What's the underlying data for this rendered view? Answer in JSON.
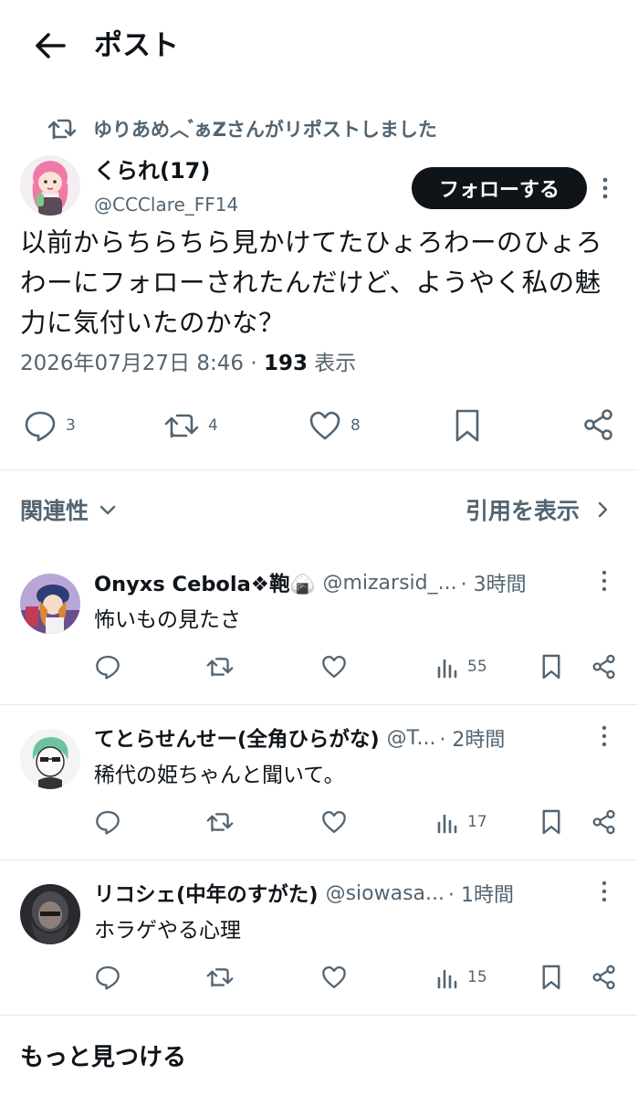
{
  "header": {
    "title": "ポスト"
  },
  "repost_notice": "ゆりあめ︿ ゙ぁZさんがリポストしました",
  "post": {
    "author_name": "くられ(17)",
    "author_handle": "@CCClare_FF14",
    "follow_label": "フォローする",
    "text": "以前からちらちら見かけてたひょろわーのひょろわーにフォローされたんだけど、ようやく私の魅力に気付いたのかな？",
    "timestamp": "2026年07月27日 8:46 · ",
    "views_count": "193",
    "views_label": " 表示",
    "replies": "3",
    "reposts": "4",
    "likes": "8"
  },
  "sort": {
    "label": "関連性",
    "quotes_label": "引用を表示"
  },
  "replies": [
    {
      "name": "Onyxs Cebola❖鞄🍙",
      "handle": "@mizarsid_...",
      "time": "· 3時間",
      "text": "怖いもの見たさ",
      "views": "55"
    },
    {
      "name": "てとらせんせー(全角ひらがな)",
      "handle": "@T...",
      "time": "· 2時間",
      "text": "稀代の姫ちゃんと聞いて。",
      "views": "17"
    },
    {
      "name": "リコシェ(中年のすがた)",
      "handle": "@siowasa...",
      "time": "· 1時間",
      "text": "ホラゲやる心理",
      "views": "15"
    }
  ],
  "discover_label": "もっと見つける",
  "colors": {
    "text": "#0f1419",
    "muted": "#536471",
    "divider": "#e6e9ec",
    "follow_bg": "#0f1419"
  },
  "icons": [
    "back-arrow-icon",
    "repost-icon",
    "more-icon",
    "reply-icon",
    "like-icon",
    "bookmark-icon",
    "share-icon",
    "views-icon",
    "chevron-down-icon",
    "chevron-right-icon"
  ]
}
